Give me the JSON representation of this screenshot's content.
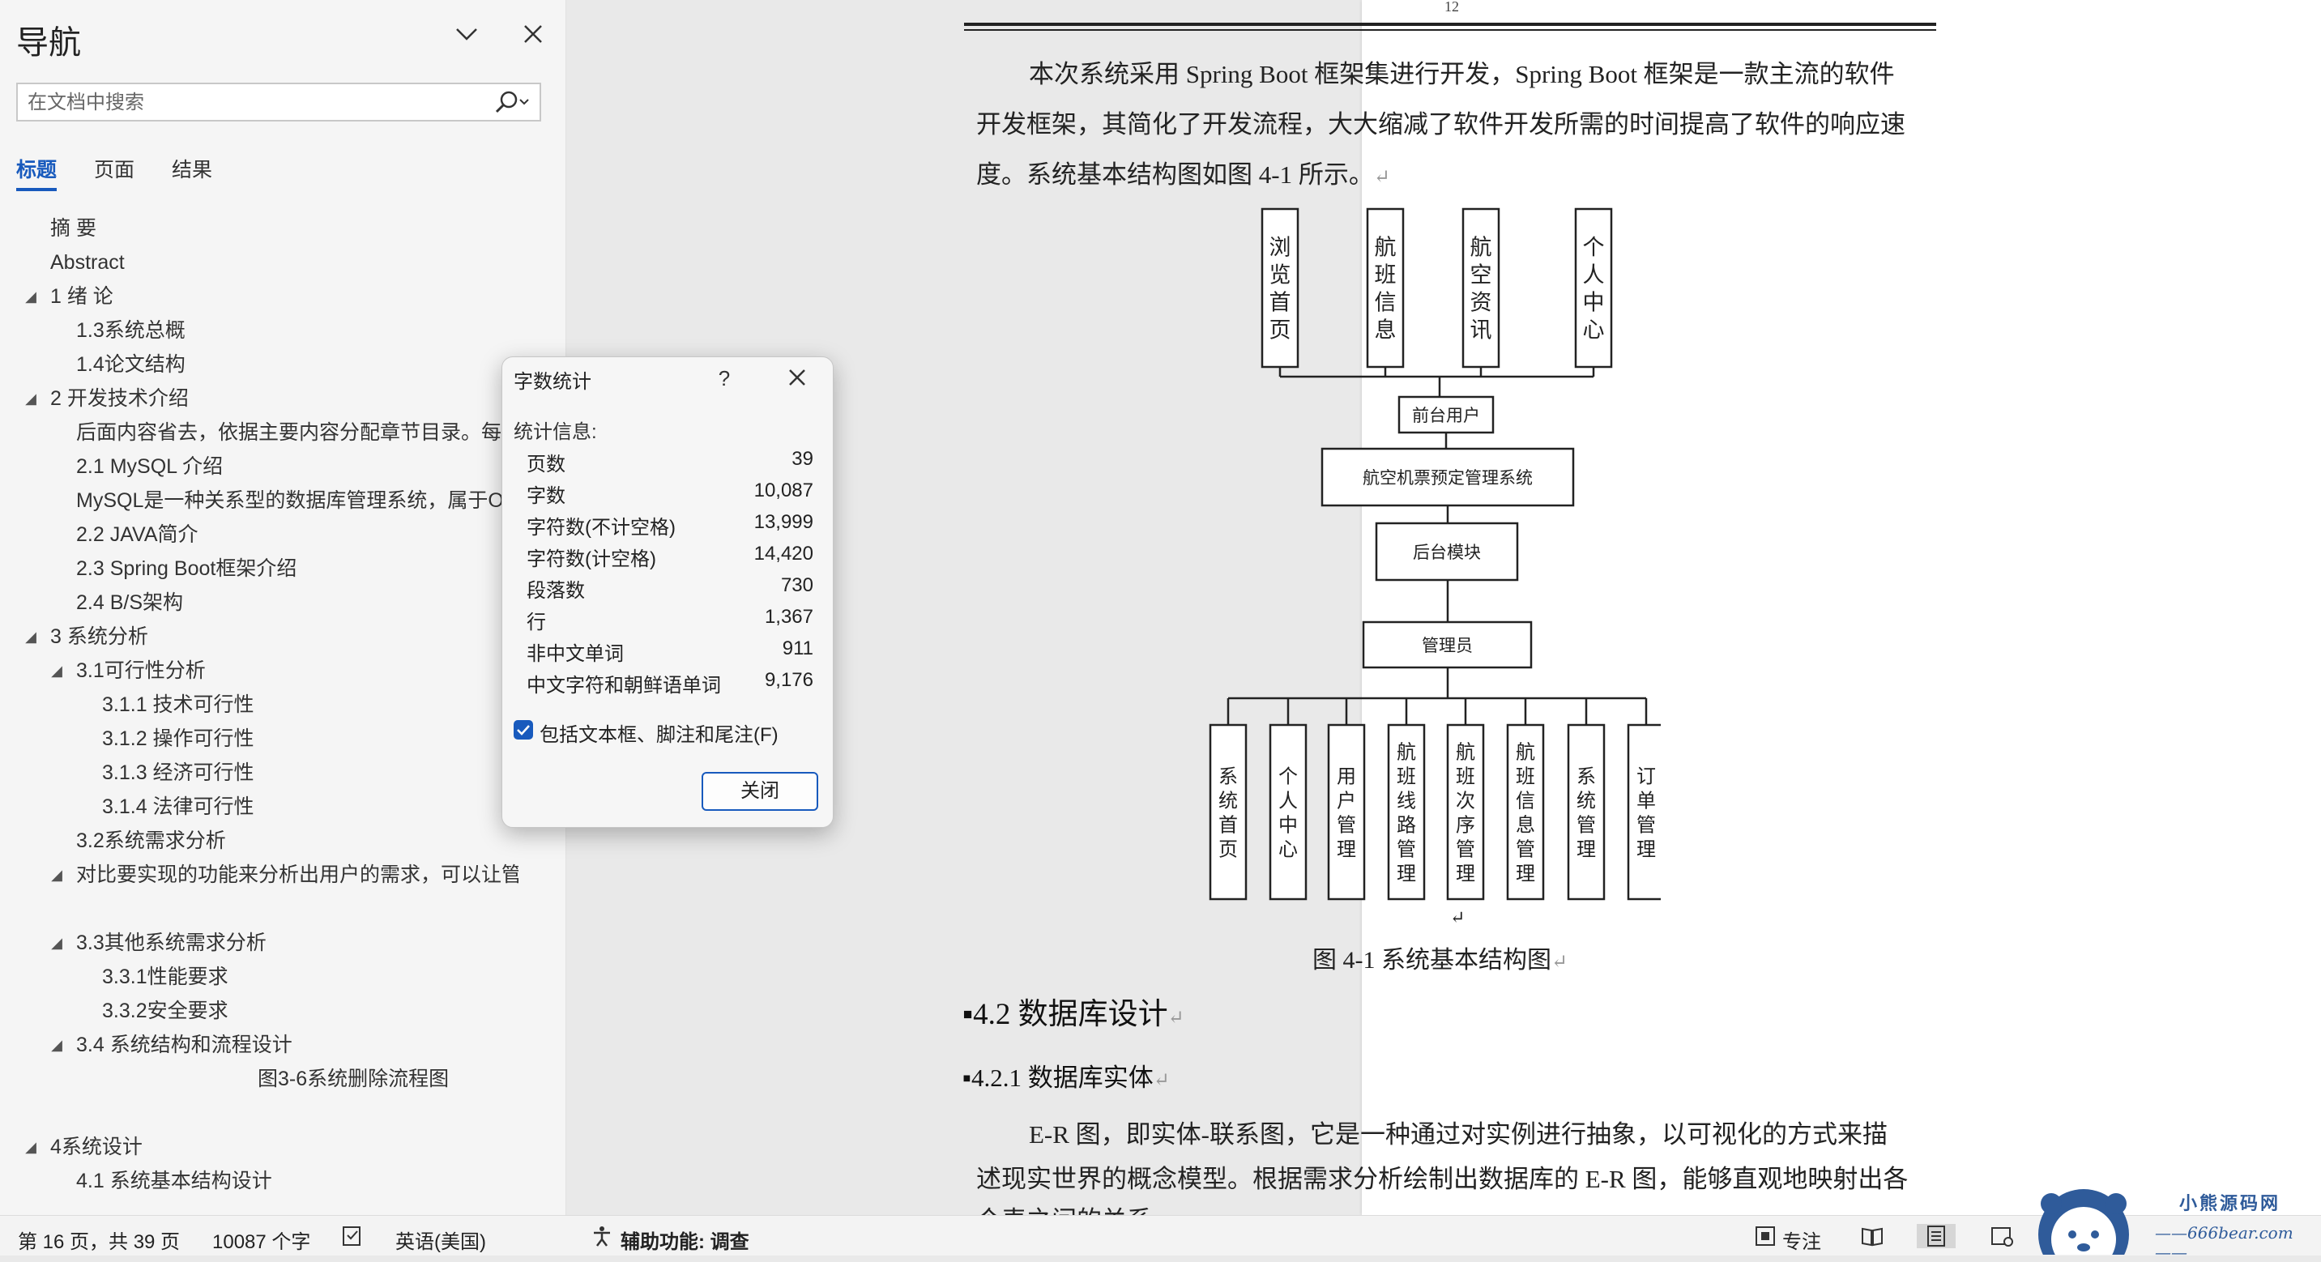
{
  "nav": {
    "title": "导航",
    "search_placeholder": "在文档中搜索",
    "tabs": [
      "标题",
      "页面",
      "结果"
    ],
    "headings": [
      {
        "text": "摘  要",
        "level": 1,
        "expander": ""
      },
      {
        "text": "Abstract",
        "level": 1,
        "expander": ""
      },
      {
        "text": "1 绪  论",
        "level": 1,
        "expander": "◢"
      },
      {
        "text": "1.3系统总概",
        "level": 2,
        "expander": ""
      },
      {
        "text": "1.4论文结构",
        "level": 2,
        "expander": ""
      },
      {
        "text": "2 开发技术介绍",
        "level": 1,
        "expander": "◢"
      },
      {
        "text": "后面内容省去，依据主要内容分配章节目录。每一",
        "level": 2,
        "expander": ""
      },
      {
        "text": "2.1 MySQL 介绍",
        "level": 2,
        "expander": ""
      },
      {
        "text": "MySQL是一种关系型的数据库管理系统，属于Or...",
        "level": 2,
        "expander": ""
      },
      {
        "text": "2.2 JAVA简介",
        "level": 2,
        "expander": ""
      },
      {
        "text": "2.3 Spring Boot框架介绍",
        "level": 2,
        "expander": ""
      },
      {
        "text": "2.4  B/S架构",
        "level": 2,
        "expander": ""
      },
      {
        "text": "3 系统分析",
        "level": 1,
        "expander": "◢"
      },
      {
        "text": "3.1可行性分析",
        "level": 2,
        "expander": "◢"
      },
      {
        "text": "3.1.1 技术可行性",
        "level": 3,
        "expander": ""
      },
      {
        "text": "3.1.2 操作可行性",
        "level": 3,
        "expander": ""
      },
      {
        "text": "3.1.3 经济可行性",
        "level": 3,
        "expander": ""
      },
      {
        "text": "3.1.4 法律可行性",
        "level": 3,
        "expander": ""
      },
      {
        "text": "3.2系统需求分析",
        "level": 2,
        "expander": ""
      },
      {
        "text": "对比要实现的功能来分析出用户的需求，可以让管...",
        "level": 2,
        "expander": "◢"
      },
      {
        "text": "",
        "level": 3,
        "expander": ""
      },
      {
        "text": "3.3其他系统需求分析",
        "level": 2,
        "expander": "◢"
      },
      {
        "text": "3.3.1性能要求",
        "level": 3,
        "expander": ""
      },
      {
        "text": "3.3.2安全要求",
        "level": 3,
        "expander": ""
      },
      {
        "text": "3.4 系统结构和流程设计",
        "level": 2,
        "expander": "◢"
      },
      {
        "text": "图3-6系统删除流程图",
        "level": 4,
        "expander": ""
      },
      {
        "text": "",
        "level": 1,
        "expander": ""
      },
      {
        "text": "4系统设计",
        "level": 1,
        "expander": "◢"
      },
      {
        "text": "4.1 系统基本结构设计",
        "level": 2,
        "expander": ""
      }
    ]
  },
  "dialog": {
    "title": "字数统计",
    "help": "?",
    "stats_label": "统计信息:",
    "stats": [
      {
        "label": "页数",
        "value": "39"
      },
      {
        "label": "字数",
        "value": "10,087"
      },
      {
        "label": "字符数(不计空格)",
        "value": "13,999"
      },
      {
        "label": "字符数(计空格)",
        "value": "14,420"
      },
      {
        "label": "段落数",
        "value": "730"
      },
      {
        "label": "行",
        "value": "1,367"
      },
      {
        "label": "非中文单词",
        "value": "911"
      },
      {
        "label": "中文字符和朝鲜语单词",
        "value": "9,176"
      }
    ],
    "include_label": "包括文本框、脚注和尾注(F)",
    "include_checked": true,
    "close_label": "关闭"
  },
  "document": {
    "header_page_number": "12",
    "para1": [
      "本次系统采用 Spring Boot 框架集进行开发，Spring Boot 框架是一款主流的软件",
      "开发框架，其简化了开发流程，大大缩减了软件开发所需的时间提高了软件的响应速",
      "度。系统基本结构图如图 4-1 所示。"
    ],
    "return_mark": "↵",
    "figure_caption": "图 4-1    系统基本结构图",
    "heading_4_2": "4.2  数据库设计",
    "heading_4_2_1": "4.2.1  数据库实体",
    "para2": [
      "E-R 图，即实体-联系图，它是一种通过对实例进行抽象，以可视化的方式来描",
      "述现实世界的概念模型。根据需求分析绘制出数据库的 E-R 图，能够直观地映射出各",
      "个表之间的关系。"
    ],
    "diagram": {
      "top_boxes": [
        "浏览首页",
        "航班信息",
        "航空资讯",
        "个人中心"
      ],
      "front_user": "前台用户",
      "system": "航空机票预定管理系统",
      "backend": "后台模块",
      "admin": "管理员",
      "bottom_boxes": [
        "系统首页",
        "个人中心",
        "用户管理",
        "航班线路管理",
        "航班次序管理",
        "航班信息管理",
        "系统管理",
        "订单管理"
      ]
    }
  },
  "statusbar": {
    "page_info": "第 16 页，共 39 页",
    "word_count": "10087 个字",
    "language": "英语(美国)",
    "accessibility": "辅助功能: 调查",
    "focus": "专注"
  },
  "watermark": {
    "name": "小熊源码网",
    "url": "——666bear.com——"
  }
}
